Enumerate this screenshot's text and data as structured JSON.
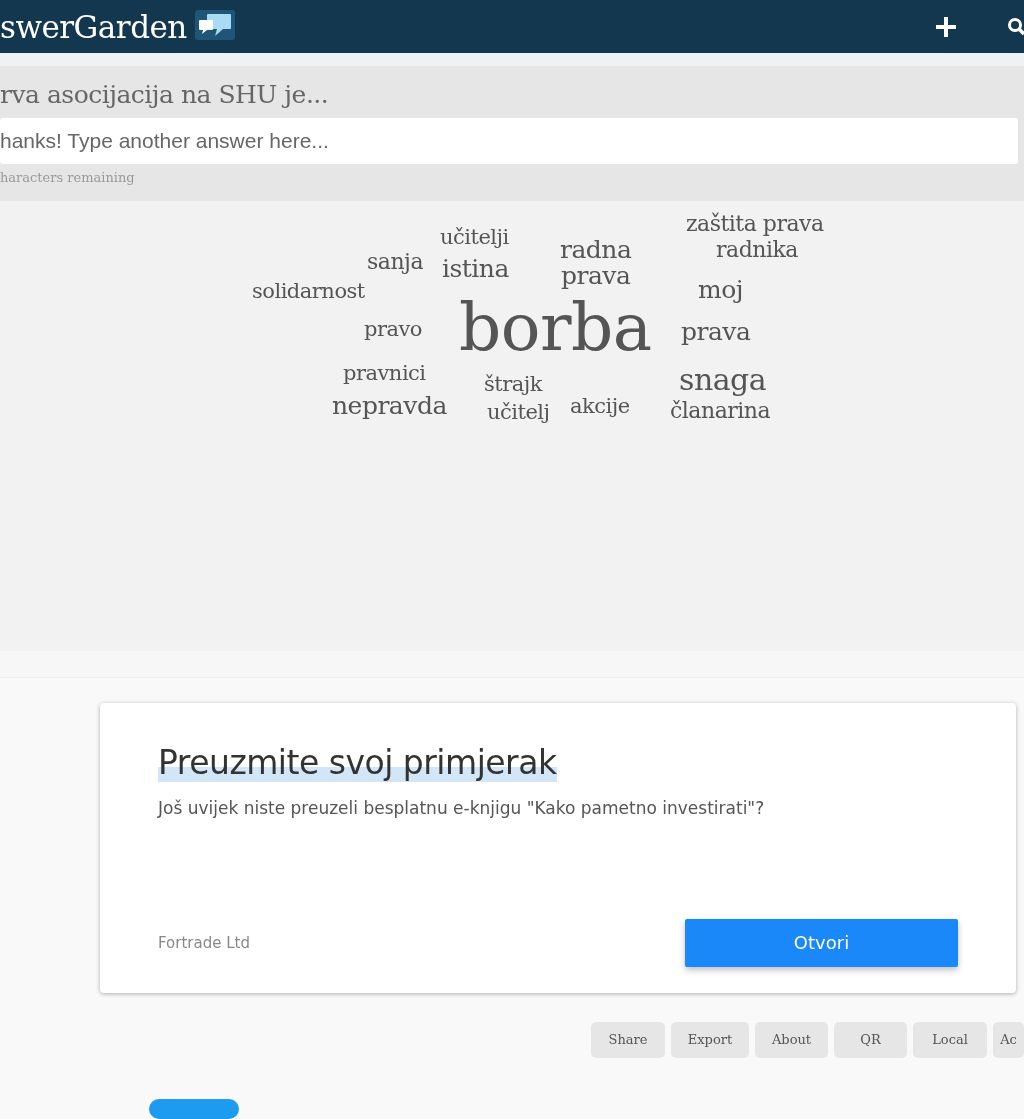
{
  "header": {
    "brand": "swerGarden"
  },
  "question": {
    "title": "rva asocijacija na SHU je...",
    "input": {
      "placeholder": "hanks! Type another answer here..."
    },
    "hint": "haracters remaining"
  },
  "word_cloud": {
    "words": [
      {
        "text": "zaštita prava"
      },
      {
        "text": "učitelji"
      },
      {
        "text": "radna"
      },
      {
        "text": "radnika"
      },
      {
        "text": "sanja"
      },
      {
        "text": "istina"
      },
      {
        "text": "prava"
      },
      {
        "text": "solidarnost"
      },
      {
        "text": "moj"
      },
      {
        "text": "pravo"
      },
      {
        "text": "borba"
      },
      {
        "text": "prava"
      },
      {
        "text": "pravnici"
      },
      {
        "text": "štrajk"
      },
      {
        "text": "snaga"
      },
      {
        "text": "nepravda"
      },
      {
        "text": "učitelj"
      },
      {
        "text": "akcije"
      },
      {
        "text": "članarina"
      }
    ]
  },
  "ad": {
    "title": "Preuzmite svoj primjerak",
    "body": "Još uvijek niste preuzeli besplatnu e-knjigu \"Kako pametno investirati\"?",
    "advertiser": "Fortrade Ltd",
    "button": "Otvori"
  },
  "actions": [
    "Share",
    "Export",
    "About",
    "QR",
    "Local",
    "Ac"
  ]
}
